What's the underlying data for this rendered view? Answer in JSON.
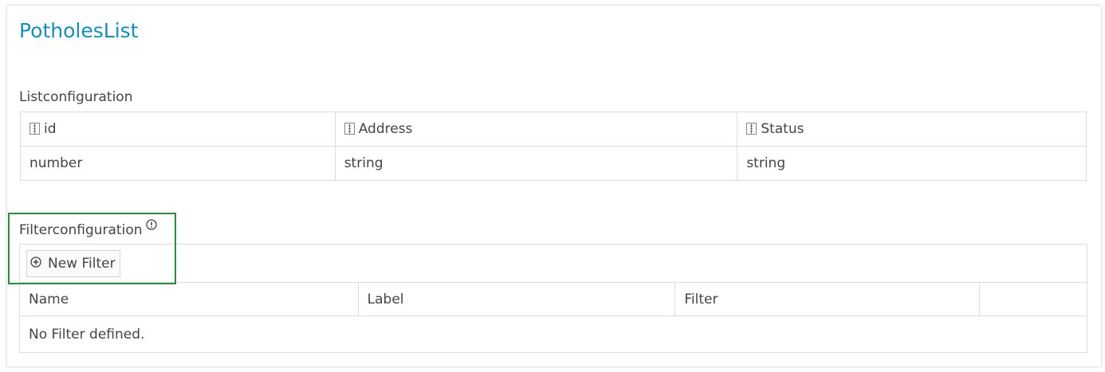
{
  "page": {
    "title": "PotholesList"
  },
  "list_configuration": {
    "label": "Listconfiguration",
    "columns": [
      {
        "name": "id",
        "type": "number"
      },
      {
        "name": "Address",
        "type": "string"
      },
      {
        "name": "Status",
        "type": "string"
      }
    ]
  },
  "filter_configuration": {
    "label": "Filterconfiguration",
    "new_filter_label": "New Filter",
    "headers": [
      "Name",
      "Label",
      "Filter",
      ""
    ],
    "empty_message": "No Filter defined."
  },
  "colors": {
    "title": "#1a8db8",
    "highlight": "#2e8b3e",
    "border": "#dcdcdc"
  }
}
